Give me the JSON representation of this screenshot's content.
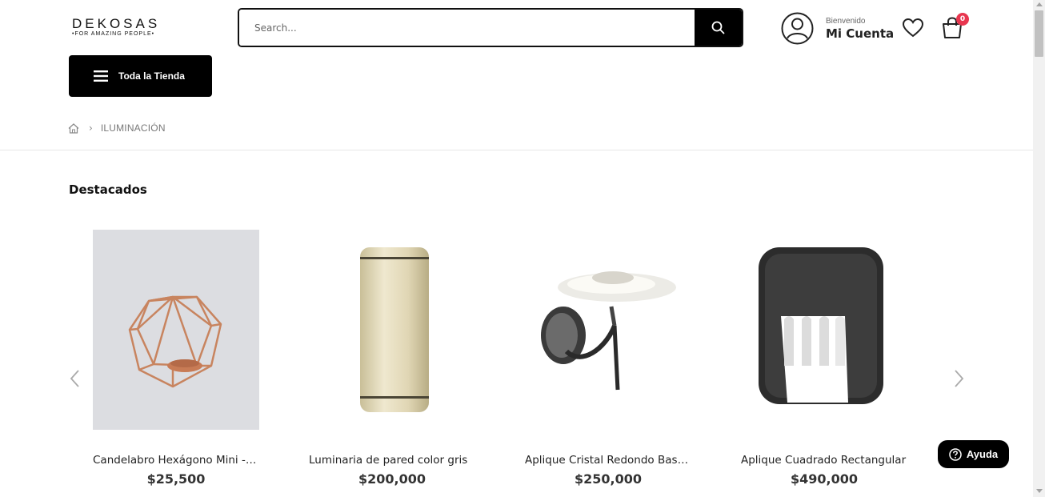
{
  "header": {
    "logo_text": "DEKOSAS",
    "logo_tagline": "•FOR AMAZING PEOPLE•",
    "search": {
      "placeholder": "Search...",
      "icon": "search-icon"
    },
    "account": {
      "welcome": "Bienvenido",
      "name": "Mi Cuenta",
      "icon": "user-icon"
    },
    "wishlist": {
      "icon": "heart-icon"
    },
    "cart": {
      "icon": "shopping-bag-icon",
      "count": "0"
    },
    "shop_button": {
      "label": "Toda la Tienda",
      "icon": "menu-icon"
    }
  },
  "breadcrumb": {
    "home_icon": "home-icon",
    "current": "ILUMINACIÓN"
  },
  "section": {
    "title": "Destacados"
  },
  "products": [
    {
      "name": "Candelabro Hexágono Mini - Cobre",
      "price": "$25,500",
      "image": "copper-hexagon-candle-holder"
    },
    {
      "name": "Luminaria de pared color gris",
      "price": "$200,000",
      "image": "cylinder-wall-lamp"
    },
    {
      "name": "Aplique Cristal Redondo Bastón",
      "price": "$250,000",
      "image": "round-glass-wall-sconce"
    },
    {
      "name": "Aplique Cuadrado Rectangular",
      "price": "$490,000",
      "image": "square-wall-light"
    }
  ],
  "help": {
    "label": "Ayuda",
    "icon": "question-icon"
  },
  "colors": {
    "primary": "#000000",
    "badge": "#e8364f",
    "text": "#222222",
    "muted": "#777777"
  }
}
